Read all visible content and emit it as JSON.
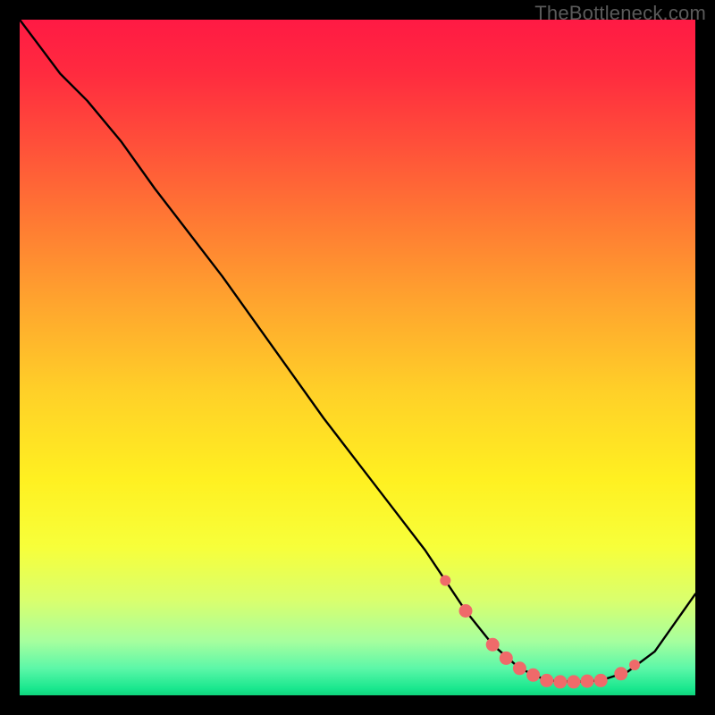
{
  "watermark": "TheBottleneck.com",
  "colors": {
    "curve_stroke": "#000000",
    "marker_fill": "#ef6a6a",
    "marker_stroke": "#ef6a6a"
  },
  "chart_data": {
    "type": "line",
    "title": "",
    "xlabel": "",
    "ylabel": "",
    "xlim": [
      0,
      100
    ],
    "ylim": [
      0,
      100
    ],
    "grid": false,
    "series": [
      {
        "name": "bottleneck-curve",
        "x": [
          0,
          3,
          6,
          10,
          15,
          20,
          25,
          30,
          35,
          40,
          45,
          50,
          55,
          60,
          63,
          66,
          70,
          74,
          78,
          82,
          86,
          90,
          94,
          100
        ],
        "y": [
          100,
          96,
          92,
          88,
          82,
          75,
          68.5,
          62,
          55,
          48,
          41,
          34.5,
          28,
          21.5,
          17,
          12.5,
          7.5,
          4,
          2.2,
          2.0,
          2.2,
          3.5,
          6.5,
          15
        ]
      }
    ],
    "markers": {
      "name": "highlighted-range",
      "x": [
        63,
        66,
        70,
        72,
        74,
        76,
        78,
        80,
        82,
        84,
        86,
        89,
        91
      ],
      "y": [
        17,
        12.5,
        7.5,
        5.5,
        4.0,
        3.0,
        2.2,
        2.0,
        2.0,
        2.1,
        2.2,
        3.2,
        4.5
      ]
    }
  }
}
